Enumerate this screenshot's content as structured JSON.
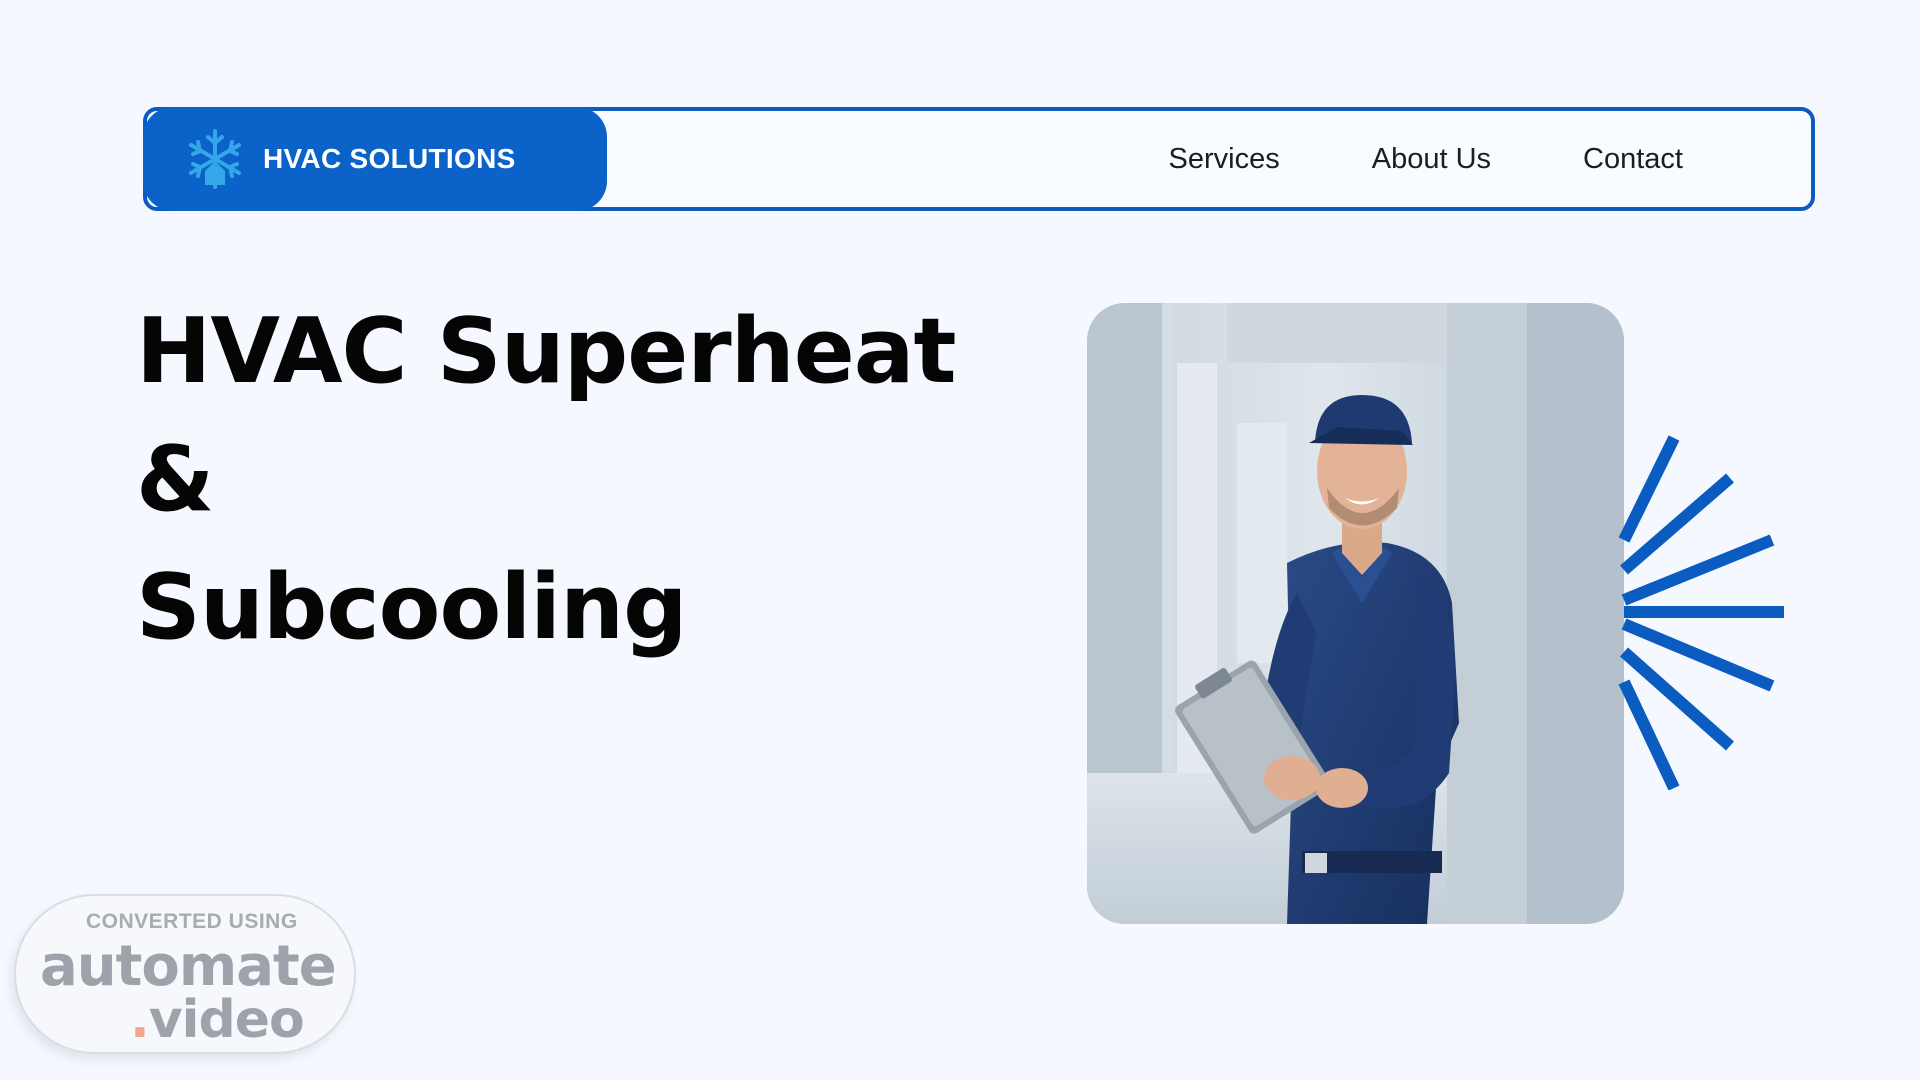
{
  "brand": {
    "name": "HVAC SOLUTIONS",
    "icon": "snowflake-house-icon"
  },
  "nav": {
    "links": [
      {
        "label": "Services"
      },
      {
        "label": "About Us"
      },
      {
        "label": "Contact"
      }
    ]
  },
  "hero": {
    "title_line1": "HVAC Superheat &",
    "title_line2": "Subcooling"
  },
  "photo": {
    "subject": "technician-with-clipboard"
  },
  "watermark": {
    "line1": "CONVERTED USING",
    "line2": "automate",
    "line3_dot": ".",
    "line3": "video"
  },
  "colors": {
    "accent": "#0b62c9",
    "border": "#0b5cc1",
    "background": "#f5f9ff",
    "text": "#050505"
  }
}
